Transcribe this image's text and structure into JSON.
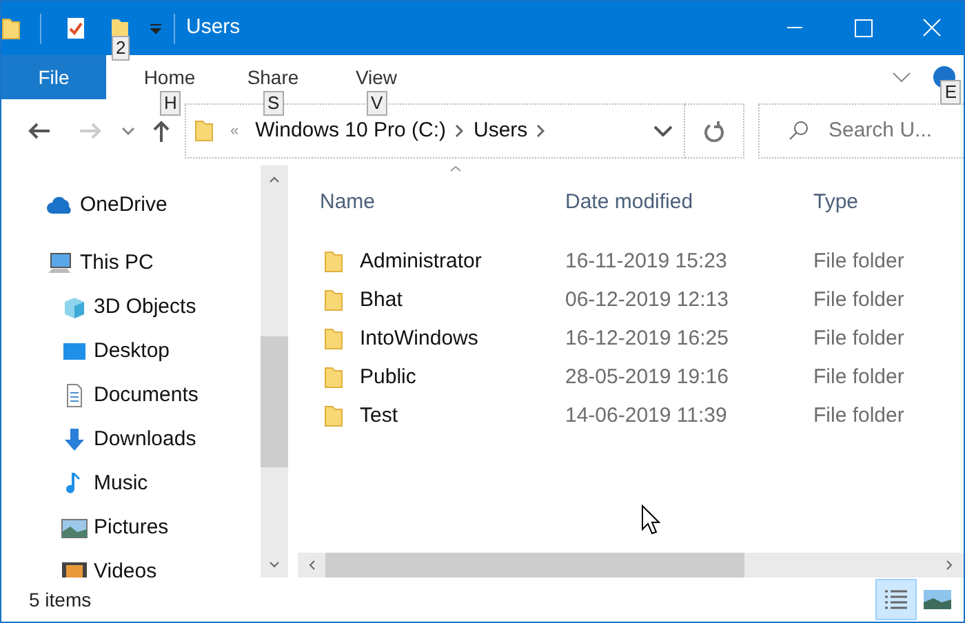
{
  "window": {
    "title": "Users",
    "quick_access_keytip": "2"
  },
  "ribbon": {
    "tabs": [
      {
        "label": "File",
        "kind": "file",
        "selected": false
      },
      {
        "label": "Home",
        "kind": "tab",
        "keytip": "H",
        "selected": false
      },
      {
        "label": "Share",
        "kind": "tab",
        "keytip": "S",
        "selected": false
      },
      {
        "label": "View",
        "kind": "tab",
        "keytip": "V",
        "selected": false
      }
    ],
    "help_keytip": "E"
  },
  "address": {
    "overflow": "«",
    "path": [
      "Windows 10 Pro (C:)",
      "Users"
    ]
  },
  "search": {
    "placeholder": "Search U..."
  },
  "nav": [
    {
      "label": "OneDrive",
      "kind": "cloud"
    },
    {
      "label": "This PC",
      "kind": "pc",
      "children": [
        {
          "label": "3D Objects",
          "kind": "cube"
        },
        {
          "label": "Desktop",
          "kind": "desktop"
        },
        {
          "label": "Documents",
          "kind": "doc"
        },
        {
          "label": "Downloads",
          "kind": "download"
        },
        {
          "label": "Music",
          "kind": "music"
        },
        {
          "label": "Pictures",
          "kind": "pictures"
        },
        {
          "label": "Videos",
          "kind": "videos"
        }
      ]
    }
  ],
  "table": {
    "columns": [
      "Name",
      "Date modified",
      "Type"
    ],
    "rows": [
      [
        "Administrator",
        "16-11-2019 15:23",
        "File folder"
      ],
      [
        "Bhat",
        "06-12-2019 12:13",
        "File folder"
      ],
      [
        "IntoWindows",
        "16-12-2019 16:25",
        "File folder"
      ],
      [
        "Public",
        "28-05-2019 19:16",
        "File folder"
      ],
      [
        "Test",
        "14-06-2019 11:39",
        "File folder"
      ]
    ]
  },
  "status_bar": {
    "text": "5 items",
    "views": [
      {
        "kind": "details",
        "selected": true
      },
      {
        "kind": "large",
        "selected": false
      }
    ]
  }
}
